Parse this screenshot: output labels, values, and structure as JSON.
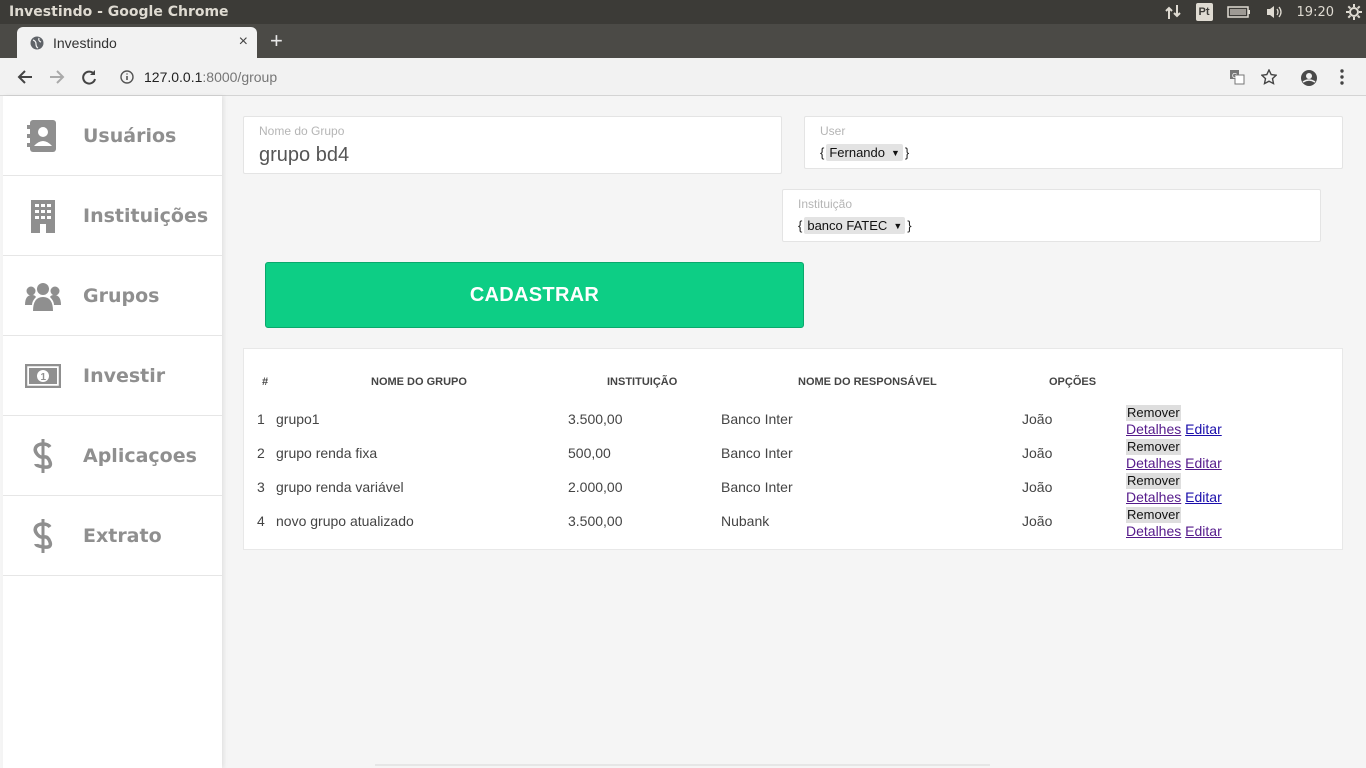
{
  "os": {
    "window_title": "Investindo - Google Chrome",
    "tray_lang": "Pt",
    "clock": "19:20"
  },
  "browser": {
    "tab_title": "Investindo",
    "tab_close": "×",
    "new_tab": "+",
    "url_host": "127.0.0.1",
    "url_path": ":8000/group"
  },
  "sidebar": {
    "items": [
      {
        "label": "Usuários",
        "icon": "address-book-icon"
      },
      {
        "label": "Instituições",
        "icon": "building-icon"
      },
      {
        "label": "Grupos",
        "icon": "users-icon"
      },
      {
        "label": "Investir",
        "icon": "money-bill-icon"
      },
      {
        "label": "Aplicaçoes",
        "icon": "dollar-icon"
      },
      {
        "label": "Extrato",
        "icon": "dollar-icon"
      }
    ]
  },
  "form": {
    "nome_label": "Nome do Grupo",
    "nome_value": "grupo bd4",
    "user_label": "User",
    "user_value": "Fernando",
    "inst_label": "Instituição",
    "inst_value": "banco FATEC",
    "brace_open": "{",
    "brace_close": "}",
    "submit_label": "CADASTRAR"
  },
  "table": {
    "headers": {
      "num": "#",
      "nome": "NOME DO GRUPO",
      "instituicao": "INSTITUIÇÃO",
      "responsavel": "NOME DO RESPONSÁVEL",
      "opcoes": "OPÇÕES"
    },
    "rows": [
      {
        "num": "1",
        "nome": "grupo1",
        "valor": "3.500,00",
        "instituicao": "Banco Inter",
        "responsavel": "João"
      },
      {
        "num": "2",
        "nome": "grupo renda fixa",
        "valor": "500,00",
        "instituicao": "Banco Inter",
        "responsavel": "João"
      },
      {
        "num": "3",
        "nome": "grupo renda variável",
        "valor": "2.000,00",
        "instituicao": "Banco Inter",
        "responsavel": "João"
      },
      {
        "num": "4",
        "nome": "novo grupo atualizado",
        "valor": "3.500,00",
        "instituicao": "Nubank",
        "responsavel": "João"
      }
    ],
    "actions": {
      "remove": "Remover",
      "details": "Detalhes",
      "edit": "Editar"
    }
  },
  "colors": {
    "accent": "#0dce85",
    "sidebar_text": "#8f8f8f"
  }
}
